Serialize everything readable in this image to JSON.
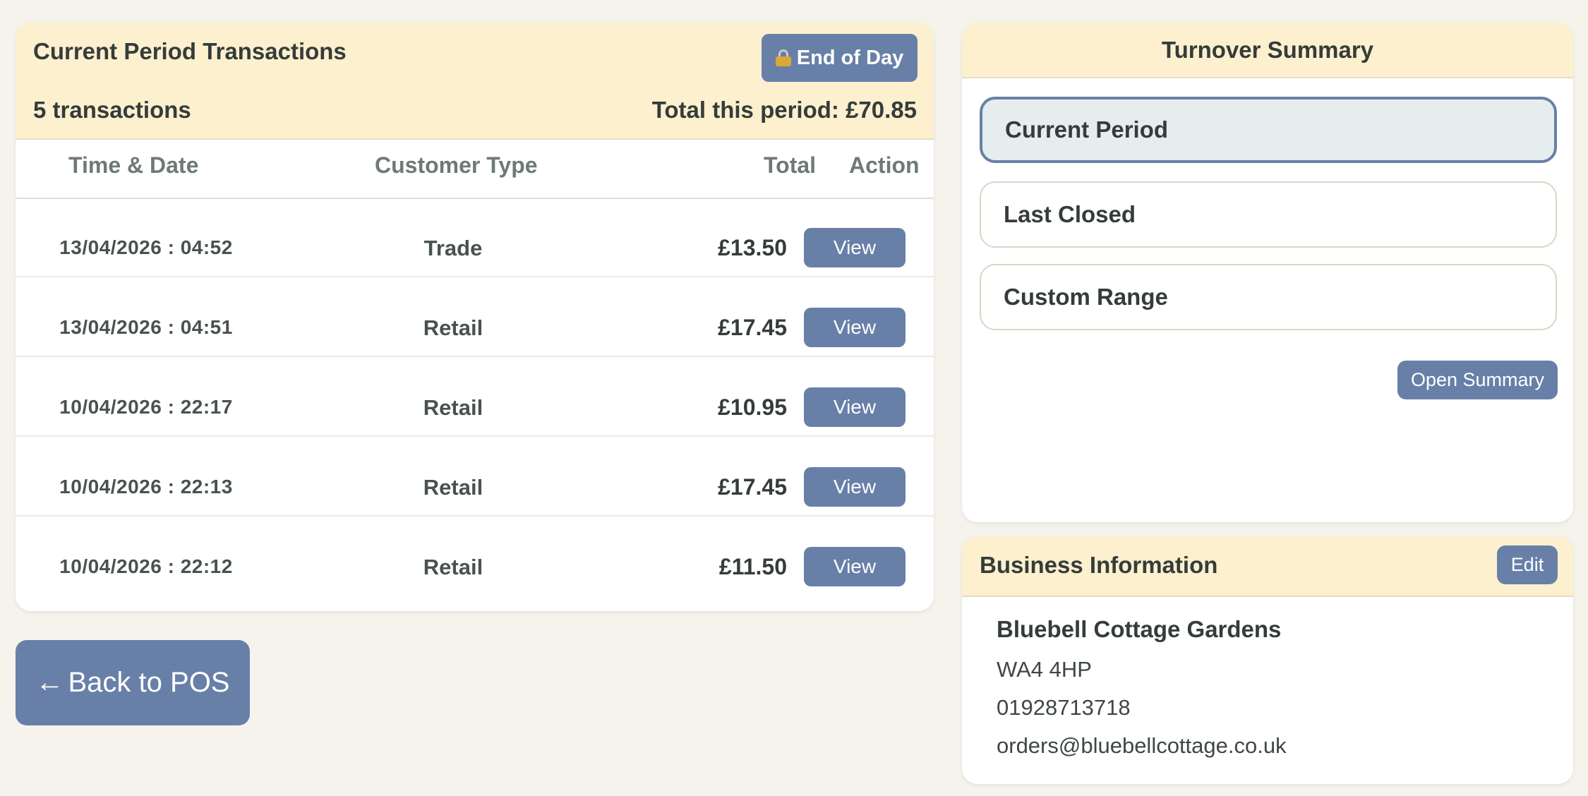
{
  "transactions": {
    "title": "Current Period Transactions",
    "end_of_day_label": "End of Day",
    "count_label": "5 transactions",
    "total_label": "Total this period: £70.85",
    "columns": {
      "time_date": "Time & Date",
      "customer_type": "Customer Type",
      "total": "Total",
      "action": "Action"
    },
    "rows": [
      {
        "datetime": "13/04/2026 : 04:52",
        "customer_type": "Trade",
        "total": "£13.50",
        "action": "View"
      },
      {
        "datetime": "13/04/2026 : 04:51",
        "customer_type": "Retail",
        "total": "£17.45",
        "action": "View"
      },
      {
        "datetime": "10/04/2026 : 22:17",
        "customer_type": "Retail",
        "total": "£10.95",
        "action": "View"
      },
      {
        "datetime": "10/04/2026 : 22:13",
        "customer_type": "Retail",
        "total": "£17.45",
        "action": "View"
      },
      {
        "datetime": "10/04/2026 : 22:12",
        "customer_type": "Retail",
        "total": "£11.50",
        "action": "View"
      }
    ]
  },
  "back_button": {
    "arrow": "←",
    "label": "Back to POS"
  },
  "turnover": {
    "title": "Turnover Summary",
    "options": [
      {
        "label": "Current Period",
        "selected": true
      },
      {
        "label": "Last Closed",
        "selected": false
      },
      {
        "label": "Custom Range",
        "selected": false
      }
    ],
    "open_summary_label": "Open Summary"
  },
  "business": {
    "title": "Business Information",
    "edit_label": "Edit",
    "name": "Bluebell Cottage Gardens",
    "postcode": "WA4 4HP",
    "phone": "01928713718",
    "email": "orders@bluebellcottage.co.uk"
  },
  "colors": {
    "accent": "#6880a8",
    "header_bg": "#fcf0cf",
    "page_bg": "#f6f3ed"
  }
}
